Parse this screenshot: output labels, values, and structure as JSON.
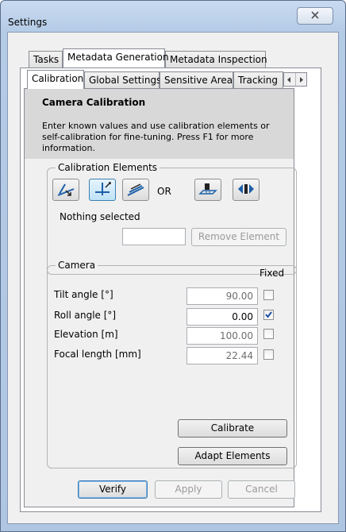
{
  "window": {
    "title": "Settings"
  },
  "tabs_top": [
    "Tasks",
    "Metadata Generation",
    "Metadata Inspection"
  ],
  "tabs_sub": [
    "Calibration",
    "Global Settings",
    "Sensitive Area",
    "Tracking"
  ],
  "header": {
    "title": "Camera Calibration",
    "description": "Enter known values and use calibration elements or self-calibration for fine-tuning. Press F1 for more information."
  },
  "calibration_elements": {
    "label": "Calibration Elements",
    "or_label": "OR",
    "status": "Nothing selected",
    "remove_button": "Remove Element",
    "tools": [
      "tool-tilt-icon",
      "tool-vertical-icon",
      "tool-horizontal-icon",
      "tool-grid-icon",
      "tool-diamond-icon"
    ]
  },
  "camera": {
    "label": "Camera",
    "fixed_label": "Fixed",
    "params": [
      {
        "label": "Tilt angle [°]",
        "value": "90.00",
        "fixed": false
      },
      {
        "label": "Roll angle [°]",
        "value": "0.00",
        "fixed": true
      },
      {
        "label": "Elevation [m]",
        "value": "100.00",
        "fixed": false
      },
      {
        "label": "Focal length [mm]",
        "value": "22.44",
        "fixed": false
      }
    ],
    "calibrate_button": "Calibrate",
    "adapt_button": "Adapt Elements"
  },
  "footer": {
    "verify": "Verify",
    "apply": "Apply",
    "cancel": "Cancel"
  },
  "colors": {
    "accent": "#3c7fb1",
    "checkmark": "#1b4fa0"
  }
}
